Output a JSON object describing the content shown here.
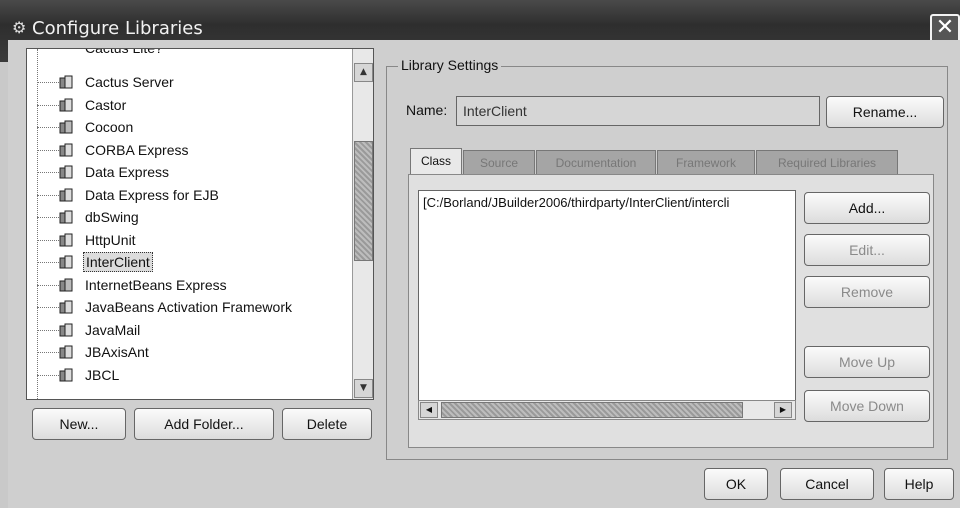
{
  "window": {
    "title": "Configure Libraries",
    "close_glyph": "✕",
    "title_icon": "gear-icon"
  },
  "tree": {
    "partial_top_label": "Cactus Lite?",
    "items": [
      {
        "label": "Cactus Server",
        "icon": "library-icon"
      },
      {
        "label": "Castor",
        "icon": "library-icon"
      },
      {
        "label": "Cocoon",
        "icon": "library-bean-icon"
      },
      {
        "label": "CORBA Express",
        "icon": "library-icon"
      },
      {
        "label": "Data Express",
        "icon": "library-icon"
      },
      {
        "label": "Data Express for EJB",
        "icon": "library-icon"
      },
      {
        "label": "dbSwing",
        "icon": "library-icon"
      },
      {
        "label": "HttpUnit",
        "icon": "library-icon"
      },
      {
        "label": "InterClient",
        "icon": "library-icon",
        "selected": true
      },
      {
        "label": "InternetBeans Express",
        "icon": "library-bean-icon"
      },
      {
        "label": "JavaBeans Activation Framework",
        "icon": "library-icon"
      },
      {
        "label": "JavaMail",
        "icon": "library-icon"
      },
      {
        "label": "JBAxisAnt",
        "icon": "library-icon"
      },
      {
        "label": "JBCL",
        "icon": "library-icon"
      }
    ]
  },
  "left_buttons": {
    "new": "New...",
    "add_folder": "Add Folder...",
    "delete": "Delete"
  },
  "settings": {
    "legend": "Library Settings",
    "name_label": "Name:",
    "name_value": "InterClient",
    "rename": "Rename..."
  },
  "tabs": [
    {
      "label": "Class",
      "active": true
    },
    {
      "label": "Source",
      "active": false
    },
    {
      "label": "Documentation",
      "active": false
    },
    {
      "label": "Framework",
      "active": false
    },
    {
      "label": "Required Libraries",
      "active": false
    }
  ],
  "class_paths": [
    "[C:/Borland/JBuilder2006/thirdparty/InterClient/intercli"
  ],
  "side_buttons": {
    "add": "Add...",
    "edit": "Edit...",
    "remove": "Remove",
    "move_up": "Move Up",
    "move_down": "Move Down"
  },
  "bottom_buttons": {
    "ok": "OK",
    "cancel": "Cancel",
    "help": "Help"
  }
}
